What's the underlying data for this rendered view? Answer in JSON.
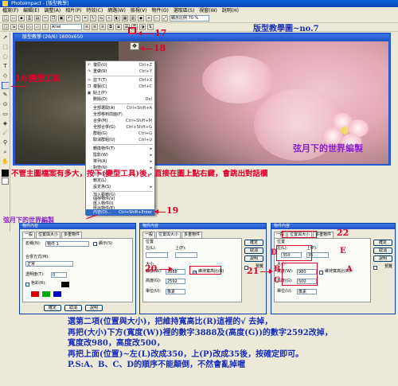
{
  "app": {
    "title": "PhotoImpact - [版型教學]",
    "menu": [
      "檔案(F)",
      "編輯(E)",
      "調整(A)",
      "相片(P)",
      "特效(C)",
      "網路(W)",
      "檢視(V)",
      "物件(O)",
      "選取區(S)",
      "視窗(W)",
      "說明(H)"
    ],
    "toolbar_zoom": "顯示比例 70 %",
    "toolbar_style": "Arial"
  },
  "document": {
    "window_title": "版型教學 (26/6) 1600x650",
    "header_label": "版型教學圖~no.7",
    "watermark": "弦月下的世界編製"
  },
  "annotations": {
    "n17": "17",
    "n18": "18",
    "n16": "16",
    "n19": "19",
    "tool_label": "變型工具",
    "right_click_note": "不管主圖檔案有多大，按下(變型工具)後，直接在圖上點右鍵，會跳出對話欄",
    "left_watermark": "弦月下的世界編製",
    "n20": "20",
    "n21": "21",
    "n22": "22",
    "letter_a": "A",
    "letter_b": "B",
    "letter_c": "C",
    "letter_d": "D",
    "letter_e": "E"
  },
  "context_menu": {
    "items": [
      {
        "label": "復原(U)",
        "shortcut": "Ctrl+Z"
      },
      {
        "label": "重做(R)",
        "shortcut": "Ctrl+Y"
      },
      {
        "label": "剪下(T)",
        "shortcut": "Ctrl+X"
      },
      {
        "label": "複製(C)",
        "shortcut": "Ctrl+C"
      },
      {
        "label": "貼上(P)",
        "shortcut": ""
      },
      {
        "label": "刪除(D)",
        "shortcut": "Del"
      },
      {
        "label": "全部選取(A)",
        "shortcut": "Ctrl+Shift+A"
      },
      {
        "label": "全部移到前面(F)",
        "shortcut": ""
      },
      {
        "label": "合併(M)",
        "shortcut": "Ctrl+Shift+M"
      },
      {
        "label": "全部合併(G)",
        "shortcut": "Ctrl+Shift+G"
      },
      {
        "label": "群組(G)",
        "shortcut": "Ctrl+G"
      },
      {
        "label": "取消群組(U)",
        "shortcut": "Ctrl+U"
      },
      {
        "label": "轉換物件(T)",
        "shortcut": ""
      },
      {
        "label": "陰影(W)",
        "shortcut": ""
      },
      {
        "label": "排列(A)",
        "shortcut": ""
      },
      {
        "label": "對齊(N)",
        "shortcut": ""
      },
      {
        "label": "分佈(D)",
        "shortcut": ""
      },
      {
        "label": "鎖定(L)",
        "shortcut": ""
      },
      {
        "label": "設定為(S)",
        "shortcut": ""
      },
      {
        "label": "加入藝廊(G)",
        "shortcut": ""
      },
      {
        "label": "儲存物件(V)",
        "shortcut": ""
      },
      {
        "label": "匯入物件(I)",
        "shortcut": ""
      },
      {
        "label": "匯出物件(E)",
        "shortcut": ""
      },
      {
        "label": "內容(O)...",
        "shortcut": "Ctrl+Shift+Enter"
      }
    ]
  },
  "dialogs": {
    "title": "物件內容",
    "tab_general": "一般",
    "tab_pos_size": "位置與大小",
    "tab_multi": "多重物件",
    "name_label": "名稱(N):",
    "name_value": "物件 1",
    "show_label": "顯示(S)",
    "merge_label": "合併方式(M):",
    "merge_value": "正常",
    "transparency_label": "透明度(T):",
    "transparency_value": "0",
    "color_label": "色彩(R):",
    "position_label": "位置",
    "left_label": "左(L):",
    "top_label": "上(P):",
    "size_label": "大小",
    "width_label": "寬度(W):",
    "height_label": "高度(G):",
    "unit_label": "單位(U):",
    "unit_value": "像素",
    "keep_ratio_label": "維持寬高比(R)",
    "ok": "確定",
    "cancel": "取消",
    "help": "說明",
    "preview": "預覽",
    "d2_width": "3888",
    "d2_height": "2592",
    "d3_left": "350",
    "d3_top": "35",
    "d3_width": "980",
    "d3_height": "500"
  },
  "instructions": {
    "line1": "選第二項(位置與大小)，把維持寬高比(R)這裡的√ 去掉，",
    "line2": "再把(大小)下方(寬度(W))裡的數字3888及(高度(G))的數字2592改掉，",
    "line3": "寬度改980，高度改500，",
    "line4": "再把上面(位置)~左(L)改成350，上(P)改成35後，按確定即可。",
    "line5": "P.S:A、B、C、D的順序不能顛倒，不然會亂掉喔"
  }
}
